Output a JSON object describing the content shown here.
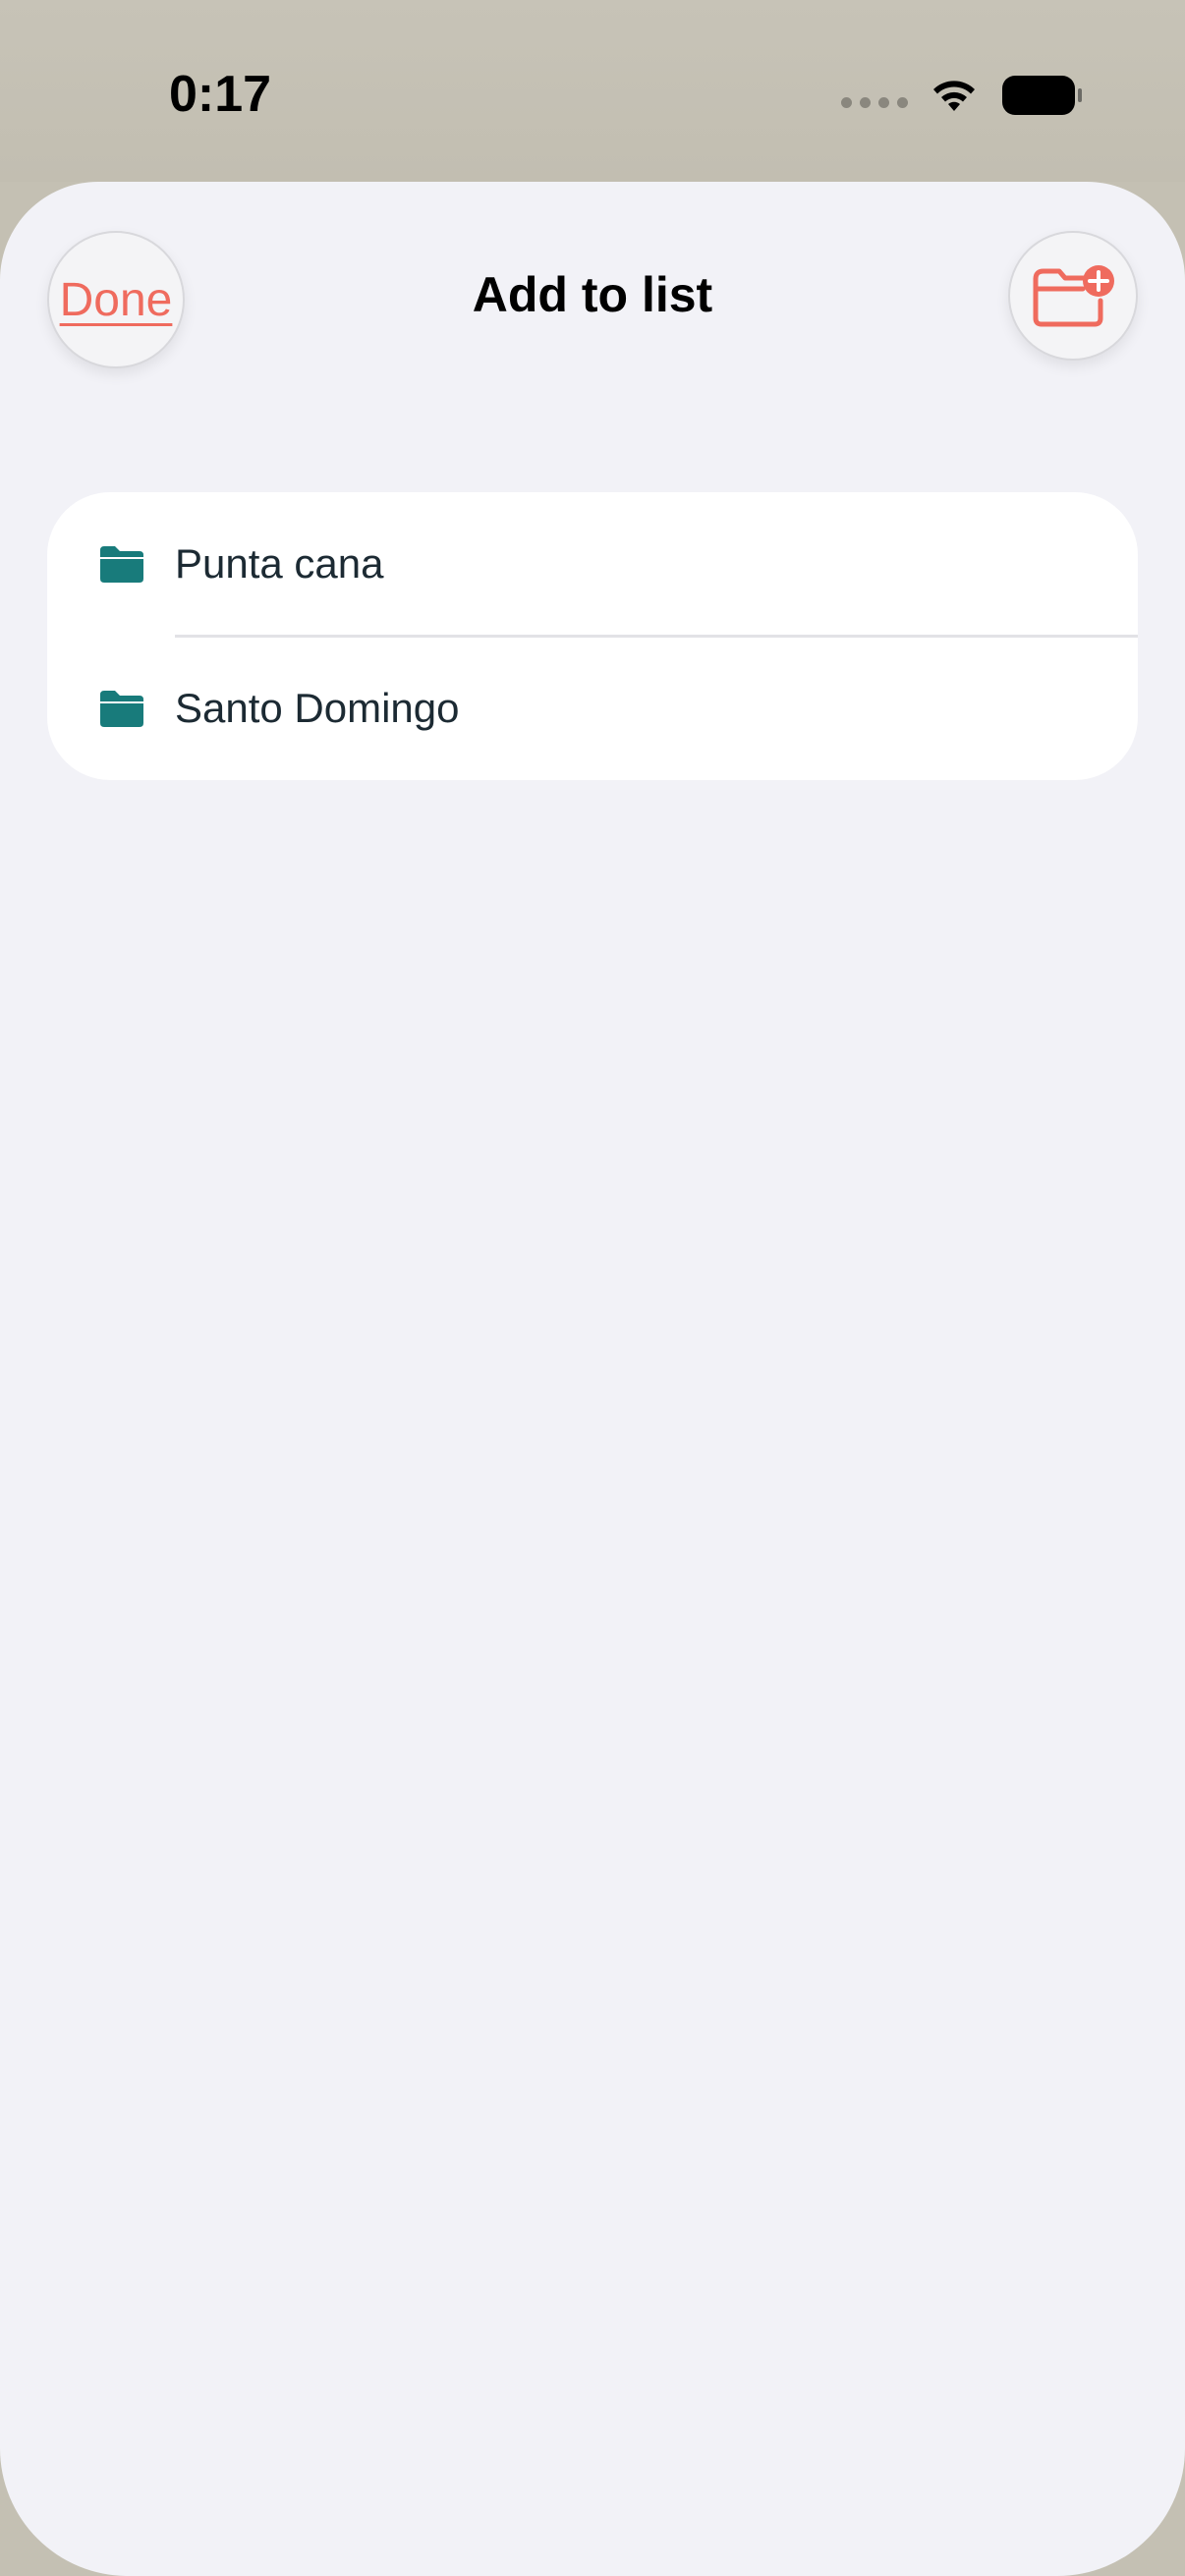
{
  "status_bar": {
    "time": "0:17"
  },
  "header": {
    "title": "Add to list",
    "done_label": "Done",
    "new_folder_icon": "folder-plus-icon"
  },
  "lists": [
    {
      "name": "Punta cana",
      "icon": "folder-icon"
    },
    {
      "name": "Santo Domingo",
      "icon": "folder-icon"
    }
  ],
  "colors": {
    "accent": "#ef6b5e",
    "folder": "#187b7b",
    "sheet_background": "#f2f2f7",
    "card_background": "#ffffff"
  }
}
